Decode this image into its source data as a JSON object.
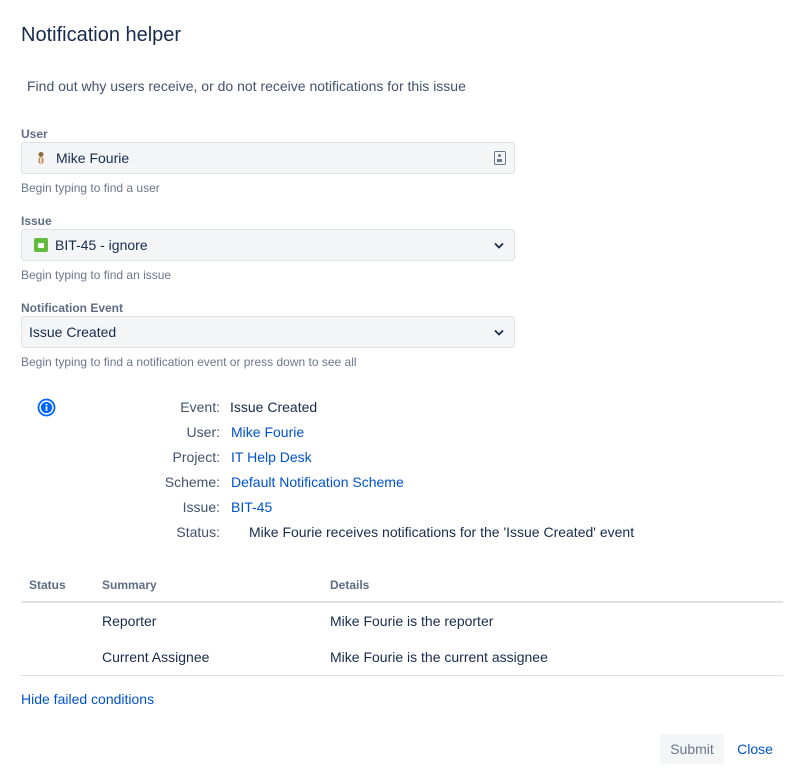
{
  "dialog": {
    "title": "Notification helper",
    "subtitle": "Find out why users receive, or do not receive notifications for this issue"
  },
  "form": {
    "user": {
      "label": "User",
      "value": "Mike Fourie",
      "help": "Begin typing to find a user",
      "icon": "user-avatar-icon"
    },
    "issue": {
      "label": "Issue",
      "value": "BIT-45 - ignore",
      "help": "Begin typing to find an issue",
      "icon": "issue-type-icon",
      "icon_color": "#63ba3c"
    },
    "event": {
      "label": "Notification Event",
      "value": "Issue Created",
      "help": "Begin typing to find a notification event or press down to see all"
    }
  },
  "result": {
    "icon": "info-icon",
    "rows": {
      "event": {
        "label": "Event:",
        "value": "Issue Created"
      },
      "user": {
        "label": "User:",
        "value": "Mike Fourie"
      },
      "project": {
        "label": "Project:",
        "value": "IT Help Desk"
      },
      "scheme": {
        "label": "Scheme:",
        "value": "Default Notification Scheme"
      },
      "issue": {
        "label": "Issue:",
        "value": "BIT-45"
      },
      "status": {
        "label": "Status:",
        "value": "Mike Fourie receives notifications for the 'Issue Created' event"
      }
    }
  },
  "table": {
    "headers": [
      "Status",
      "Summary",
      "Details"
    ],
    "rows": [
      {
        "status": "",
        "summary": "Reporter",
        "details": "Mike Fourie is the reporter"
      },
      {
        "status": "",
        "summary": "Current Assignee",
        "details": "Mike Fourie is the current assignee"
      }
    ]
  },
  "links": {
    "hide_failed": "Hide failed conditions"
  },
  "buttons": {
    "submit": "Submit",
    "close": "Close"
  },
  "colors": {
    "link": "#0052cc",
    "info": "#0065ff",
    "text": "#172b4d"
  }
}
